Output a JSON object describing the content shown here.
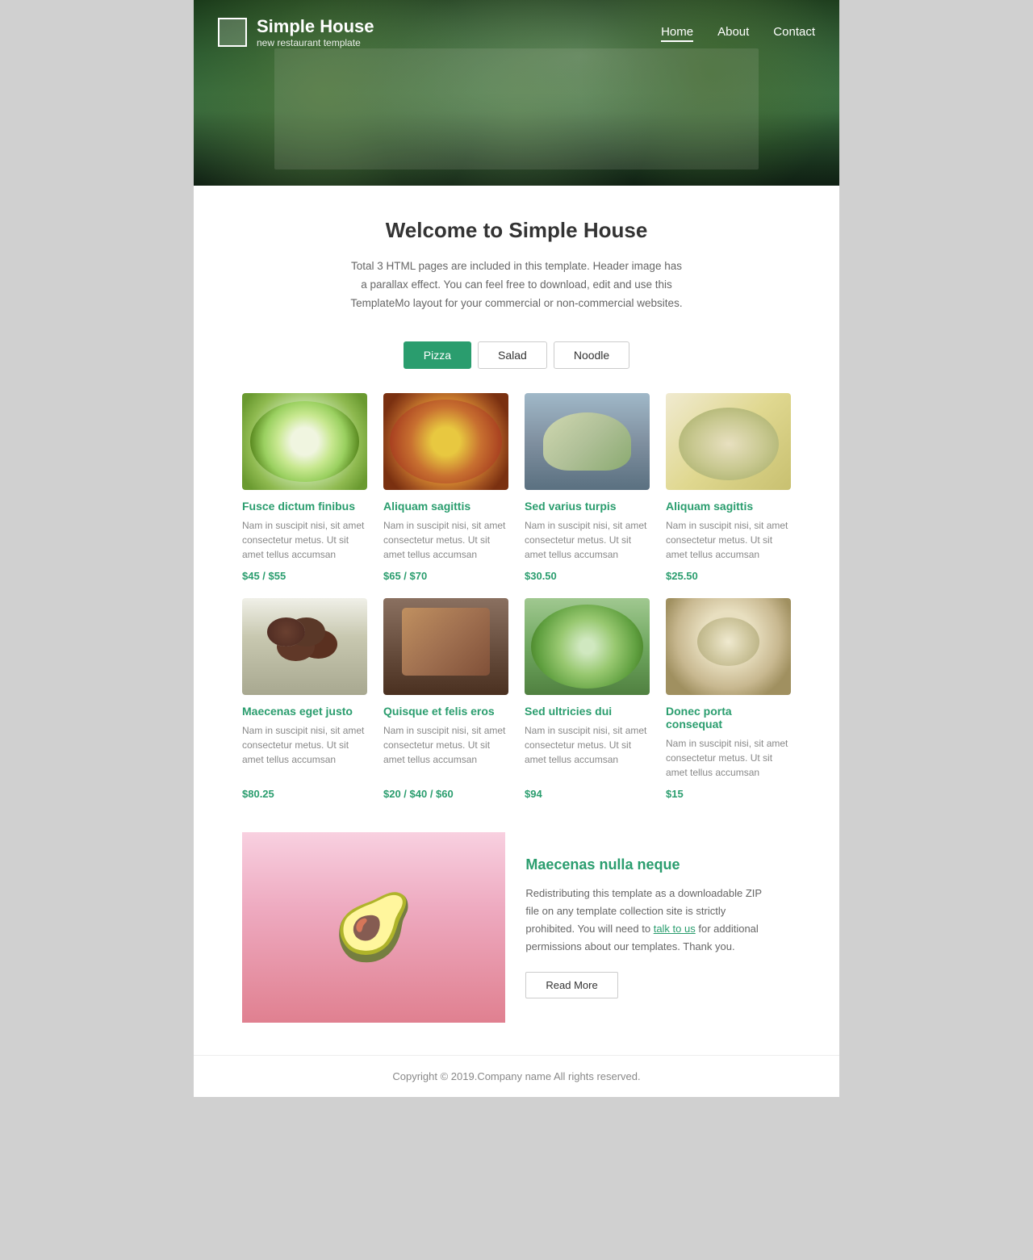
{
  "site": {
    "brand_name": "Simple House",
    "brand_tagline": "new restaurant template",
    "nav": [
      {
        "label": "Home",
        "active": true
      },
      {
        "label": "About",
        "active": false
      },
      {
        "label": "Contact",
        "active": false
      }
    ]
  },
  "welcome": {
    "title": "Welcome to Simple House",
    "description": "Total 3 HTML pages are included in this template. Header image has a parallax effect. You can feel free to download, edit and use this TemplateMo layout for your commercial or non-commercial websites."
  },
  "filters": [
    {
      "label": "Pizza",
      "active": true
    },
    {
      "label": "Salad",
      "active": false
    },
    {
      "label": "Noodle",
      "active": false
    }
  ],
  "food_items": [
    {
      "title": "Fusce dictum finibus",
      "description": "Nam in suscipit nisi, sit amet consectetur metus. Ut sit amet tellus accumsan",
      "price": "$45 / $55",
      "img_class": "img-salad-bowl"
    },
    {
      "title": "Aliquam sagittis",
      "description": "Nam in suscipit nisi, sit amet consectetur metus. Ut sit amet tellus accumsan",
      "price": "$65 / $70",
      "img_class": "img-pizza"
    },
    {
      "title": "Sed varius turpis",
      "description": "Nam in suscipit nisi, sit amet consectetur metus. Ut sit amet tellus accumsan",
      "price": "$30.50",
      "img_class": "img-fish"
    },
    {
      "title": "Aliquam sagittis",
      "description": "Nam in suscipit nisi, sit amet consectetur metus. Ut sit amet tellus accumsan",
      "price": "$25.50",
      "img_class": "img-asian-salad"
    },
    {
      "title": "Maecenas eget justo",
      "description": "Nam in suscipit nisi, sit amet consectetur metus. Ut sit amet tellus accumsan",
      "price": "$80.25",
      "img_class": "img-meatballs"
    },
    {
      "title": "Quisque et felis eros",
      "description": "Nam in suscipit nisi, sit amet consectetur metus. Ut sit amet tellus accumsan",
      "price": "$20 / $40 / $60",
      "img_class": "img-toast"
    },
    {
      "title": "Sed ultricies dui",
      "description": "Nam in suscipit nisi, sit amet consectetur metus. Ut sit amet tellus accumsan",
      "price": "$94",
      "img_class": "img-green-salad"
    },
    {
      "title": "Donec porta consequat",
      "description": "Nam in suscipit nisi, sit amet consectetur metus. Ut sit amet tellus accumsan",
      "price": "$15",
      "img_class": "img-dumplings"
    }
  ],
  "promo": {
    "title": "Maecenas nulla neque",
    "text": "Redistributing this template as a downloadable ZIP file on any template collection site is strictly prohibited. You will need to",
    "link_text": "talk to us",
    "text_after": "for additional permissions about our templates. Thank you.",
    "read_more": "Read More"
  },
  "footer": {
    "copyright": "Copyright © 2019.Company name All rights reserved."
  }
}
